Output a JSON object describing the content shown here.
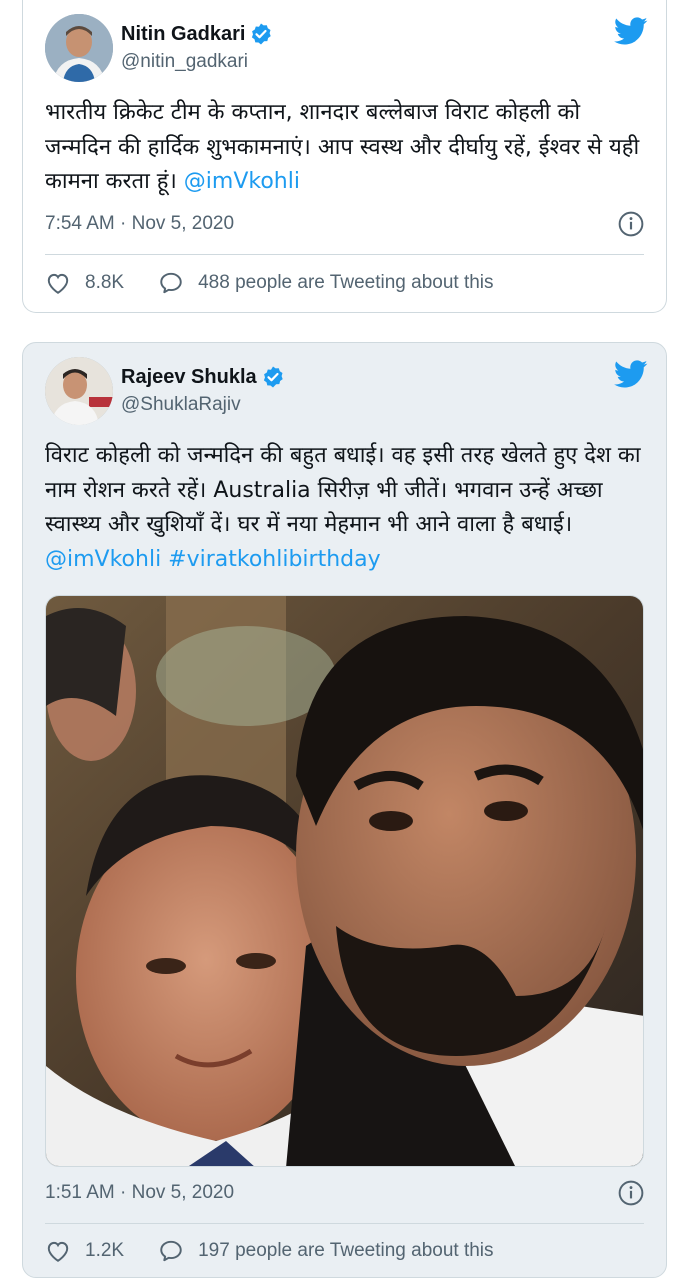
{
  "tweets": [
    {
      "name": "Nitin Gadkari",
      "handle": "@nitin_gadkari",
      "text": "भारतीय क्रिकेट टीम के कप्तान, शानदार बल्लेबाज विराट कोहली को जन्मदिन की हार्दिक शुभकामनाएं। आप स्वस्थ और दीर्घायु रहें, ईश्वर से यही कामना करता हूं। ",
      "mentions": "@imVkohli",
      "timestamp": "7:54 AM · Nov 5, 2020",
      "likes": "8.8K",
      "replies_text": "488 people are Tweeting about this"
    },
    {
      "name": "Rajeev Shukla",
      "handle": "@ShuklaRajiv",
      "text": "विराट कोहली को जन्मदिन की बहुत बधाई। वह इसी तरह खेलते हुए देश का नाम रोशन करते रहें। Australia सिरीज़ भी जीतें। भगवान उन्हें अच्छा स्वास्थ्य और खुशियाँ दें। घर में नया मेहमान भी आने वाला है बधाई।",
      "mentions": "@imVkohli #viratkohlibirthday",
      "timestamp": "1:51 AM · Nov 5, 2020",
      "likes": "1.2K",
      "replies_text": "197 people are Tweeting about this"
    }
  ],
  "colors": {
    "brand": "#1d9bf0",
    "secondary_text": "#536471",
    "border": "#cfd9de"
  },
  "icons": [
    "verified-badge-icon",
    "twitter-bird-icon",
    "info-icon",
    "heart-icon",
    "speech-bubble-icon"
  ]
}
